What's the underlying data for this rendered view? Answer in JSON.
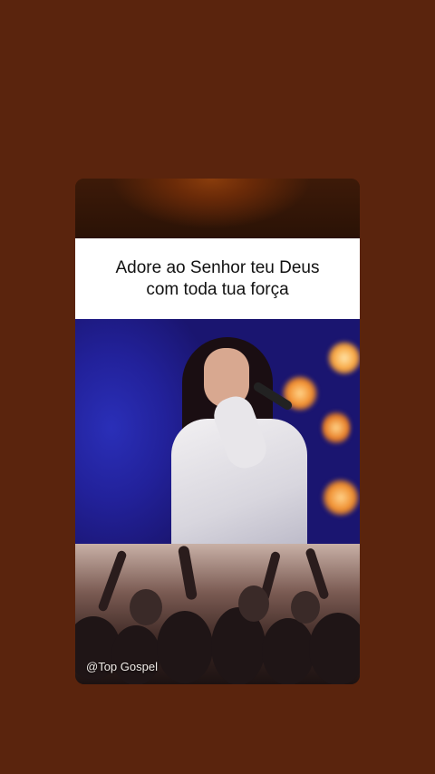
{
  "post": {
    "caption": "Adore ao Senhor teu Deus com toda tua força",
    "watermark": "@Top Gospel"
  },
  "colors": {
    "page_background": "#5a240d",
    "caption_background": "#ffffff",
    "stage_blue": "#2a2fb8"
  }
}
